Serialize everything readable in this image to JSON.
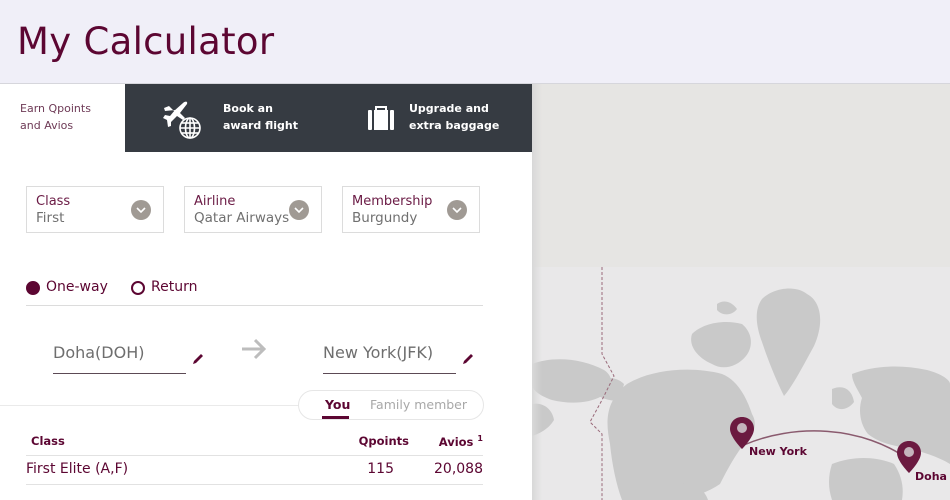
{
  "header": {
    "title": "My Calculator"
  },
  "tabs": [
    {
      "id": "earn",
      "label_line1": "Earn Qpoints",
      "label_line2": "and Avios",
      "active": true
    },
    {
      "id": "book",
      "label_line1": "Book an",
      "label_line2": "award flight",
      "icon": "plane-globe-icon",
      "active": false
    },
    {
      "id": "upgrade",
      "label_line1": "Upgrade and",
      "label_line2": "extra baggage",
      "icon": "suitcase-icon",
      "active": false
    }
  ],
  "filters": {
    "class": {
      "label": "Class",
      "value": "First"
    },
    "airline": {
      "label": "Airline",
      "value": "Qatar Airways"
    },
    "membership": {
      "label": "Membership",
      "value": "Burgundy"
    }
  },
  "trip_type": {
    "options": [
      {
        "label": "One-way",
        "selected": true
      },
      {
        "label": "Return",
        "selected": false
      }
    ]
  },
  "route": {
    "from": "Doha(DOH)",
    "to": "New York(JFK)"
  },
  "member_toggle": {
    "options": [
      {
        "label": "You",
        "selected": true
      },
      {
        "label": "Family member",
        "selected": false
      }
    ]
  },
  "results_table": {
    "columns": [
      "Class",
      "Qpoints",
      "Avios"
    ],
    "avios_footnote": "1",
    "rows": [
      {
        "class": "First Elite (A,F)",
        "qpoints": "115",
        "avios": "20,088"
      }
    ]
  },
  "map": {
    "origin_label": "Doha",
    "destination_label": "New York"
  },
  "colors": {
    "brand": "#5c0632",
    "tab_dark": "#363b42",
    "header_bg": "#f0eff8",
    "land": "#c8c8c8"
  }
}
